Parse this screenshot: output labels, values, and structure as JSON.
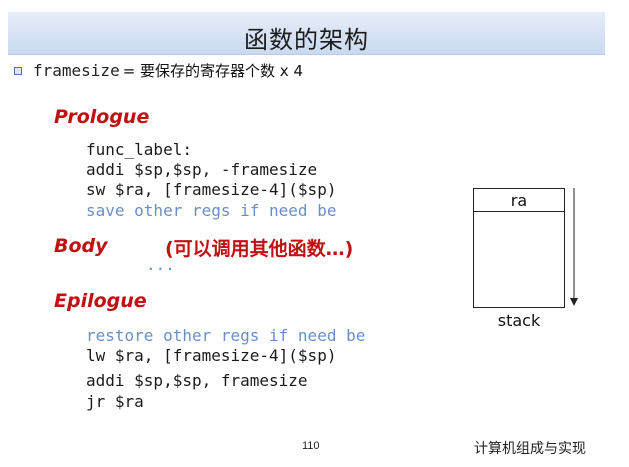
{
  "title": "函数的架构",
  "bullet": {
    "code": "framesize",
    "rest": "= 要保存的寄存器个数 x 4"
  },
  "sections": {
    "prologue": "Prologue",
    "body": "Body",
    "epilogue": "Epilogue"
  },
  "prologue_code": [
    "func_label:",
    "addi $sp,$sp, -framesize",
    "sw $ra, [framesize-4]($sp)",
    "save other regs if need be"
  ],
  "body_note": "(可以调用其他函数…)",
  "body_ellipsis": "...",
  "epilogue_code": [
    "restore other regs if need be",
    "lw $ra, [framesize-4]($sp)",
    "addi $sp,$sp, framesize",
    "jr $ra"
  ],
  "stack_diagram": {
    "cell_label": "ra",
    "caption": "stack"
  },
  "footer": {
    "page_number": "110",
    "course": "计算机组成与实现"
  },
  "colors": {
    "accent_red": "#c01212",
    "comment_blue": "#6a8fc8",
    "title_bg": "#cad9ef"
  }
}
